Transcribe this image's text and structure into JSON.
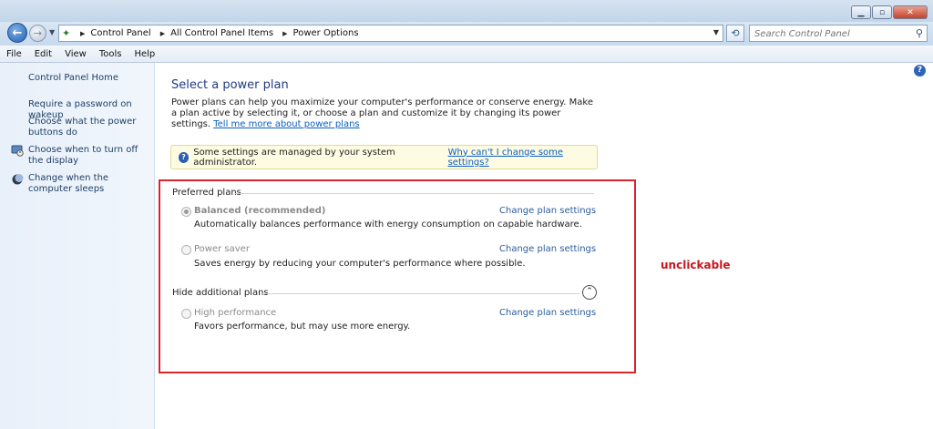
{
  "window": {
    "minimize_icon": "minimize-icon",
    "maximize_icon": "maximize-icon",
    "close_icon": "close-icon"
  },
  "navigation": {
    "breadcrumb": [
      "Control Panel",
      "All Control Panel Items",
      "Power Options"
    ],
    "search_placeholder": "Search Control Panel"
  },
  "menu": [
    "File",
    "Edit",
    "View",
    "Tools",
    "Help"
  ],
  "sidebar": {
    "home": "Control Panel Home",
    "links": [
      "Require a password on wakeup",
      "Choose what the power buttons do",
      "Choose when to turn off the display",
      "Change when the computer sleeps"
    ]
  },
  "main": {
    "title": "Select a power plan",
    "intro_text": "Power plans can help you maximize your computer's performance or conserve energy. Make a plan active by selecting it, or choose a plan and customize it by changing its power settings.",
    "intro_link": "Tell me more about power plans",
    "notice_text": "Some settings are managed by your system administrator.",
    "notice_link": "Why can't I change some settings?",
    "preferred_header": "Preferred plans",
    "additional_header": "Hide additional plans",
    "plans": [
      {
        "name": "Balanced (recommended)",
        "description": "Automatically balances performance with energy consumption on capable hardware.",
        "link": "Change plan settings",
        "selected": true
      },
      {
        "name": "Power saver",
        "description": "Saves energy by reducing your computer's performance where possible.",
        "link": "Change plan settings",
        "selected": false
      },
      {
        "name": "High performance",
        "description": "Favors performance, but may use more energy.",
        "link": "Change plan settings",
        "selected": false
      }
    ],
    "annotation": "unclickable"
  },
  "colors": {
    "annotation_red": "#d8262f",
    "link_blue": "#0a5fc1",
    "title_blue": "#1e3c80"
  }
}
